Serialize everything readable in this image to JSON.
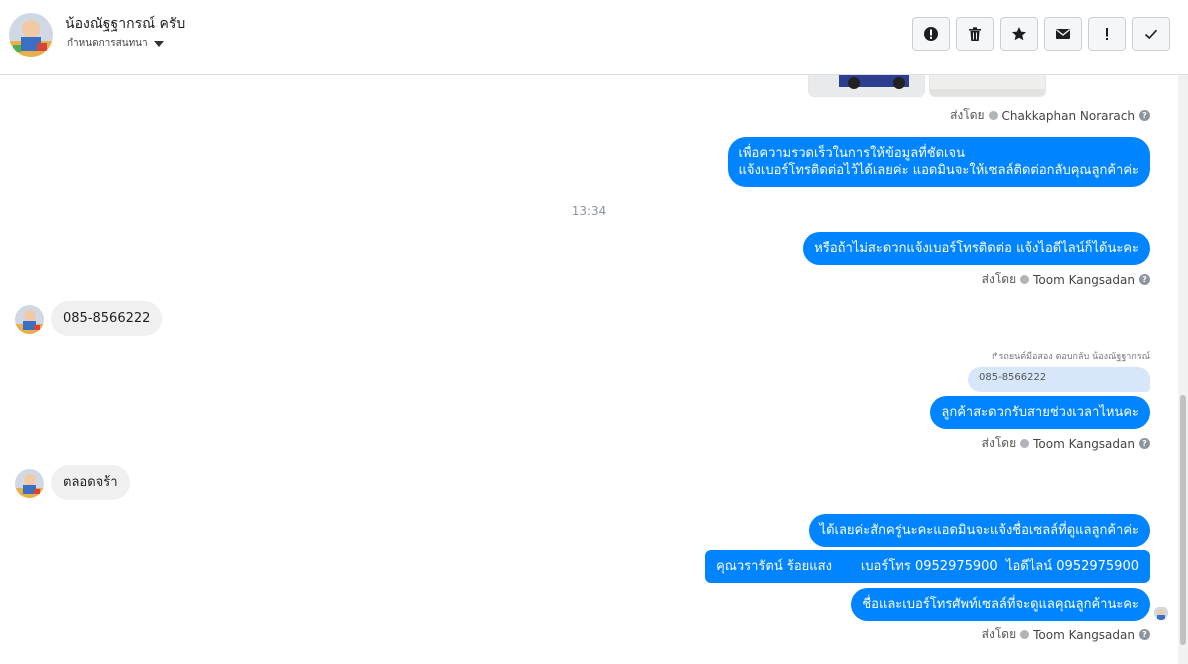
{
  "header": {
    "contact_name": "น้องณัฐฐากรณ์ ครับ",
    "subtitle": "กำหนดการสนทนา",
    "toolbar": [
      {
        "name": "report-button",
        "icon": "alert-circle-icon"
      },
      {
        "name": "delete-button",
        "icon": "trash-icon"
      },
      {
        "name": "star-button",
        "icon": "star-icon"
      },
      {
        "name": "mark-unread-button",
        "icon": "envelope-icon"
      },
      {
        "name": "important-button",
        "icon": "exclamation-icon"
      },
      {
        "name": "done-button",
        "icon": "check-icon"
      }
    ]
  },
  "messages": {
    "sent_by_prefix": "ส่งโดย",
    "m1_sender": "Chakkaphan Norarach",
    "m2_text": "เพื่อความรวดเร็วในการให้ข้อมูลที่ชัดเจน\nแจ้งเบอร์โทรติดต่อไว้ได้เลยค่ะ แอดมินจะให้เซลล์ติดต่อกลับคุณลูกค้าค่ะ",
    "time_divider": "13:34",
    "m3_text": "หรือถ้าไม่สะดวกแจ้งเบอร์โทรติดต่อ แจ้งไอดีไลน์ก็ได้นะคะ",
    "m3_sender": "Toom Kangsadan",
    "in1_text": "085-8566222",
    "reply_note": "รถยนต์มือสอง ตอบกลับ น้องณัฐฐากรณ์",
    "quoted_text": "085-8566222",
    "m4_text": "ลูกค้าสะดวกรับสายช่วงเวลาไหนคะ",
    "m4_sender": "Toom Kangsadan",
    "in2_text": "ตลอดจร้า",
    "m5_text": "ได้เลยค่ะสักครู่นะคะแอดมินจะแจ้งชื่อเซลล์ที่ดูแลลูกค้าค่ะ",
    "m6_text": "คุณวรารัตน์ ร้อยแสง       เบอร์โทร 0952975900  ไอดีไลน์ 0952975900",
    "m7_text": "ชื่อและเบอร์โทรศัพท์เซลล์ที่จะดูแลคุณลูกค้านะคะ",
    "m7_sender": "Toom Kangsadan"
  },
  "colors": {
    "outgoing_bubble": "#0084ff",
    "incoming_bubble": "#f1f0f0",
    "quoted_bubble": "#d8e6fb"
  }
}
